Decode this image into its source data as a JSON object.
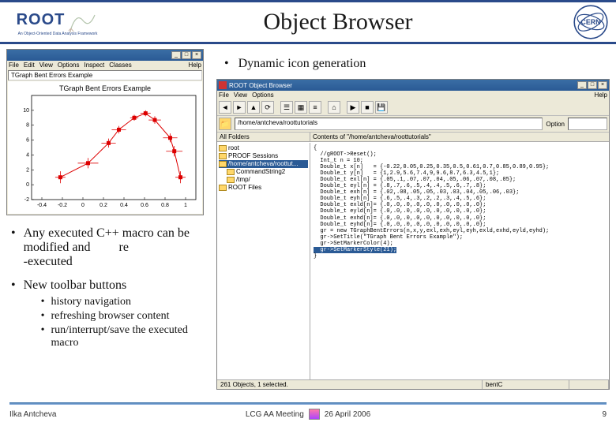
{
  "header": {
    "root_logo_text": "ROOT",
    "root_logo_sub": "An Object-Oriented Data Analysis Framework",
    "title": "Object Browser",
    "cern_label": "CERN"
  },
  "graph_window": {
    "menu": [
      "File",
      "Edit",
      "View",
      "Options",
      "Inspect",
      "Classes"
    ],
    "help": "Help",
    "canvas_title": "TGraph Bent Errors Example"
  },
  "chart_data": {
    "type": "scatter-errors",
    "title": "TGraph Bent Errors Example",
    "xlabel": "",
    "ylabel": "",
    "xlim": [
      -0.5,
      1.1
    ],
    "ylim": [
      -2,
      12
    ],
    "xticks": [
      -0.4,
      -0.2,
      0,
      0.2,
      0.4,
      0.6,
      0.8,
      1
    ],
    "yticks": [
      -2,
      0,
      2,
      4,
      6,
      8,
      10
    ],
    "x": [
      -0.22,
      0.05,
      0.25,
      0.35,
      0.5,
      0.61,
      0.7,
      0.85,
      0.89,
      0.95
    ],
    "y": [
      1.0,
      2.9,
      5.6,
      7.4,
      9.0,
      9.6,
      8.7,
      6.3,
      4.5,
      1.0
    ],
    "ex": [
      0.05,
      0.1,
      0.07,
      0.07,
      0.04,
      0.05,
      0.06,
      0.07,
      0.08,
      0.05
    ],
    "ey": [
      0.8,
      0.7,
      0.6,
      0.5,
      0.4,
      0.4,
      0.5,
      0.6,
      0.7,
      0.8
    ]
  },
  "bullets": {
    "top": "Dynamic icon generation",
    "left": [
      {
        "text_pre": "Any executed C++ macro can be modified and",
        "text_float": "re",
        "text_post": "-executed"
      },
      {
        "text": "New toolbar buttons",
        "sub": [
          "history navigation",
          "refreshing browser content",
          "run/interrupt/save the executed macro"
        ]
      }
    ]
  },
  "browser": {
    "title": "ROOT Object Browser",
    "menu": [
      "File",
      "View",
      "Options"
    ],
    "help": "Help",
    "address": "/home/antcheva/roottutorials",
    "option_label": "Option",
    "option_value": "",
    "pane_left_header": "All Folders",
    "pane_right_header": "Contents of \"/home/antcheva/roottutorials\"",
    "tree": [
      {
        "label": "root",
        "indent": 0,
        "sel": false
      },
      {
        "label": "PROOF Sessions",
        "indent": 0,
        "sel": false
      },
      {
        "label": "/home/antcheva/roottut...",
        "indent": 0,
        "sel": true
      },
      {
        "label": "CommandString2",
        "indent": 1,
        "sel": false
      },
      {
        "label": "/tmp/",
        "indent": 1,
        "sel": false
      },
      {
        "label": "ROOT Files",
        "indent": 0,
        "sel": false
      }
    ],
    "code_lines": [
      "{",
      "  //gROOT->Reset();",
      "  Int_t n = 10;",
      "  Double_t x[n]   = {-0.22,0.05,0.25,0.35,0.5,0.61,0.7,0.85,0.89,0.95};",
      "  Double_t y[n]   = {1,2.9,5.6,7.4,9,9.6,8.7,6.3,4.5,1};",
      "  Double_t exl[n] = {.05,.1,.07,.07,.04,.05,.06,.07,.08,.05};",
      "  Double_t eyl[n] = {.8,.7,.6,.5,.4,.4,.5,.6,.7,.8};",
      "  Double_t exh[n] = {.02,.08,.05,.05,.03,.03,.04,.05,.06,.03};",
      "  Double_t eyh[n] = {.6,.5,.4,.3,.2,.2,.3,.4,.5,.6};",
      "  Double_t exld[n]= {.0,.0,.0,.0,.0,.0,.0,.0,.0,.0};",
      "  Double_t eyld[n]= {.0,.0,.0,.0,.0,.0,.0,.0,.0,.0};",
      "  Double_t exhd[n]= {.0,.0,.0,.0,.0,.0,.0,.0,.0,.0};",
      "  Double_t eyhd[n]= {.0,.0,.0,.0,.0,.0,.0,.0,.0,.0};",
      "  gr = new TGraphBentErrors(n,x,y,exl,exh,eyl,eyh,exld,exhd,eyld,eyhd);",
      "  gr->SetTitle(\"TGraph Bent Errors Example\");",
      "  gr->SetMarkerColor(4);"
    ],
    "code_hl": "  gr->SetMarkerStyle(21);",
    "code_tail": "}",
    "status_left": "261 Objects, 1 selected.",
    "status_right": "bentC"
  },
  "footer": {
    "author": "Ilka Antcheva",
    "center": "LCG AA Meeting",
    "date": "26 April 2006",
    "page": "9"
  }
}
